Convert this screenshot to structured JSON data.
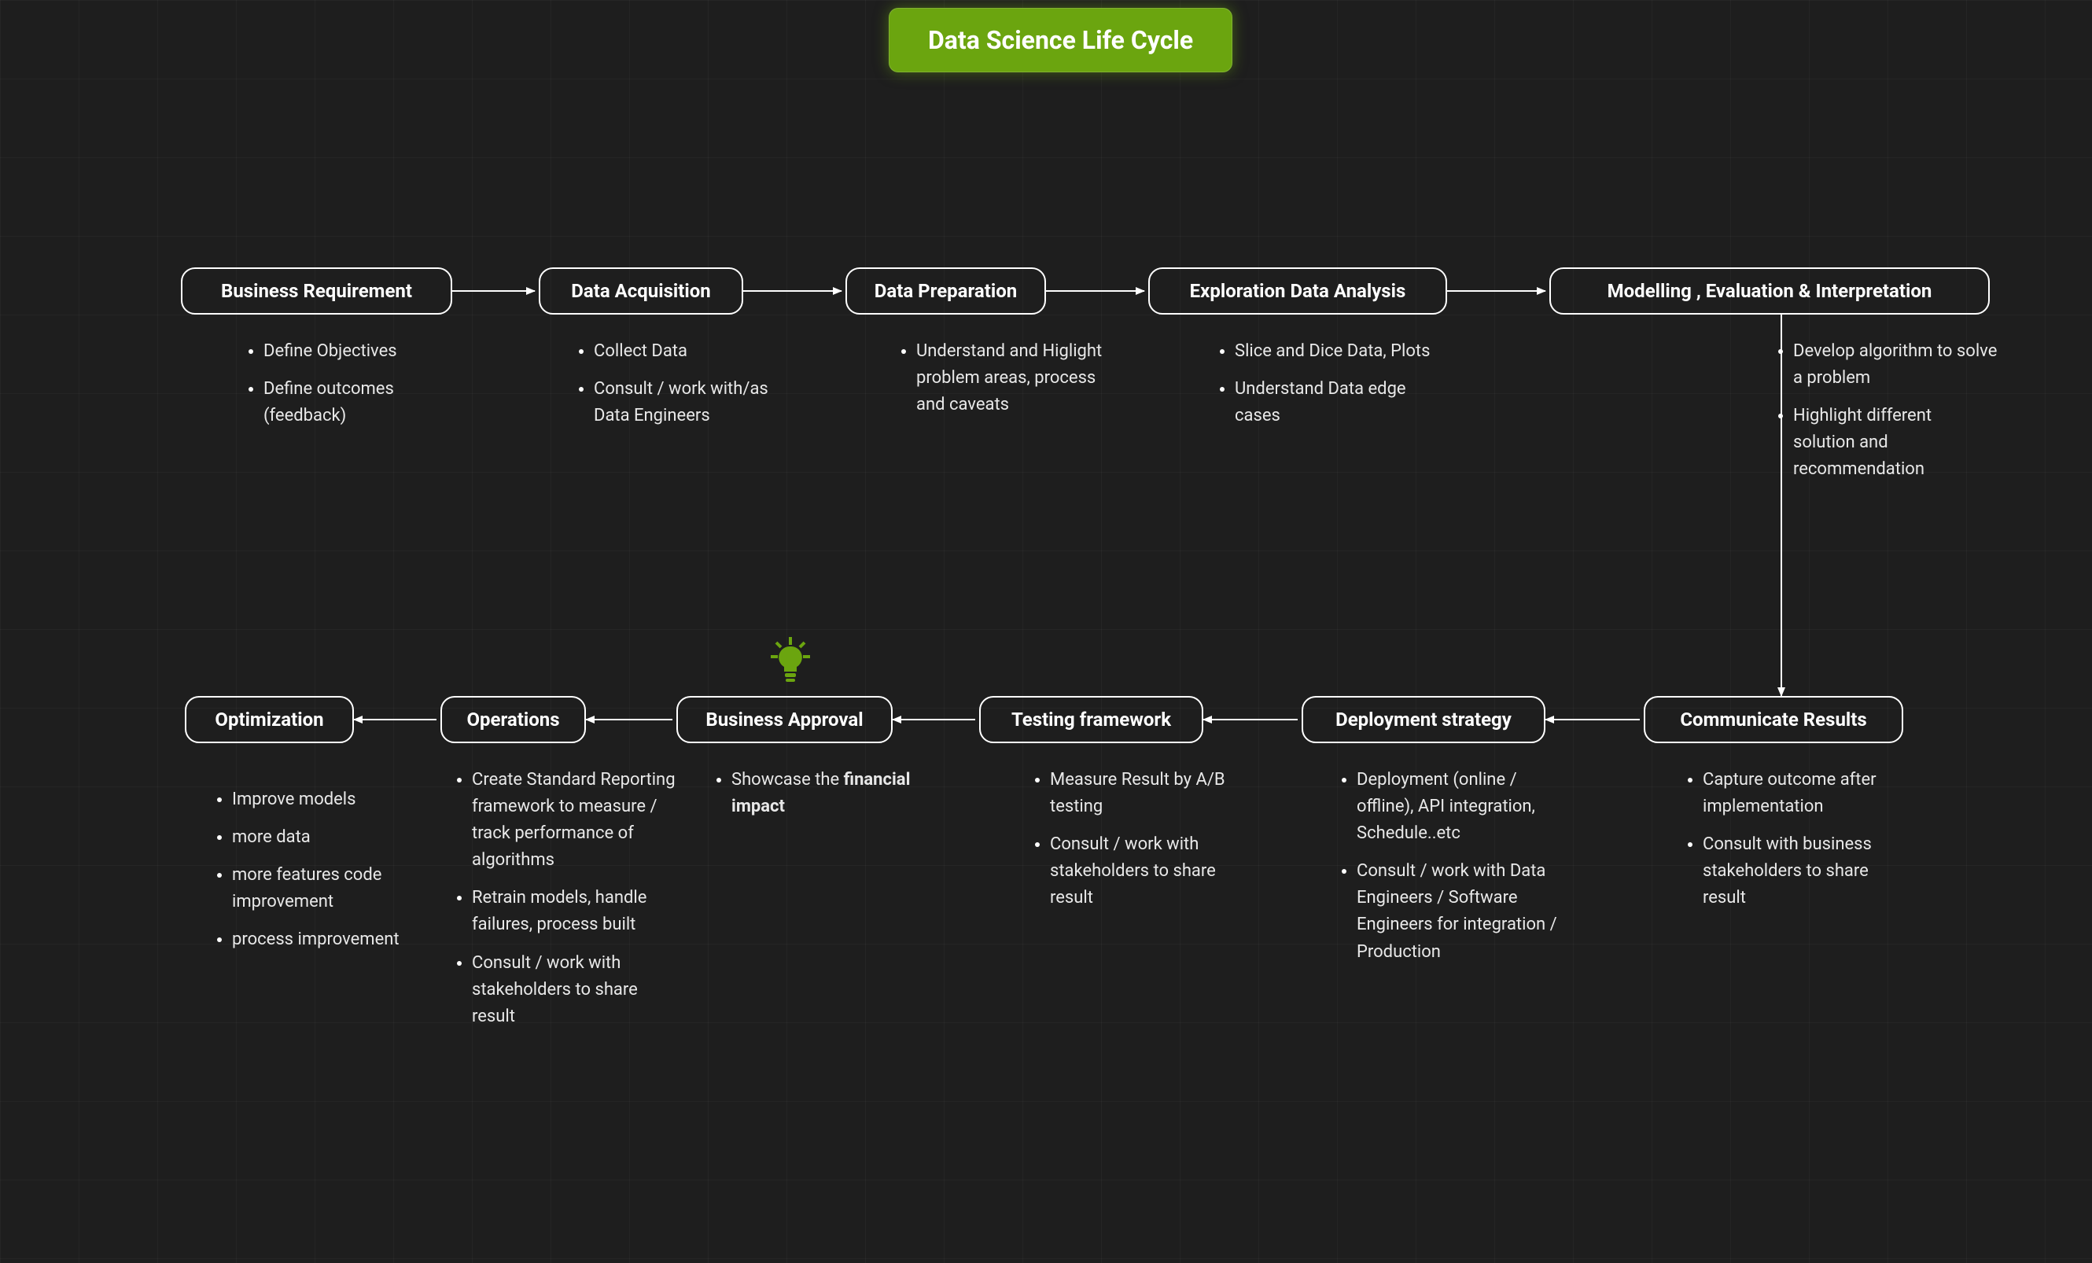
{
  "title": "Data Science Life Cycle",
  "bulb_icon_name": "lightbulb-icon",
  "nodes": {
    "business_requirement": {
      "label": "Business Requirement",
      "bullets": [
        "Define Objectives",
        "Define outcomes (feedback)"
      ]
    },
    "data_acquisition": {
      "label": "Data Acquisition",
      "bullets": [
        "Collect Data",
        "Consult / work with/as Data Engineers"
      ]
    },
    "data_preparation": {
      "label": "Data Preparation",
      "bullets": [
        "Understand and Higlight problem areas, process and caveats"
      ]
    },
    "eda": {
      "label": "Exploration Data Analysis",
      "bullets": [
        "Slice and Dice Data, Plots",
        "Understand Data edge cases"
      ]
    },
    "modelling": {
      "label": "Modelling , Evaluation & Interpretation",
      "bullets": [
        "Develop algorithm to solve a problem",
        "Highlight different solution and recommendation"
      ]
    },
    "communicate": {
      "label": "Communicate Results",
      "bullets": [
        "Capture outcome after implementation",
        "Consult with business stakeholders to share result"
      ]
    },
    "deployment": {
      "label": "Deployment strategy",
      "bullets": [
        "Deployment (online / offline), API integration, Schedule..etc",
        "Consult / work with Data Engineers / Software Engineers for integration / Production"
      ]
    },
    "testing": {
      "label": "Testing framework",
      "bullets": [
        "Measure Result by A/B testing",
        "Consult / work with stakeholders to share result"
      ]
    },
    "approval": {
      "label": "Business Approval",
      "bullets_html": "Showcase the <b>financial impact</b>"
    },
    "operations": {
      "label": "Operations",
      "bullets": [
        "Create Standard Reporting framework to measure / track performance of algorithms",
        "Retrain models, handle failures, process built",
        "Consult / work with stakeholders to share result"
      ]
    },
    "optimization": {
      "label": "Optimization",
      "bullets": [
        "Improve models",
        "more data",
        "more features code improvement",
        "process improvement"
      ]
    }
  }
}
